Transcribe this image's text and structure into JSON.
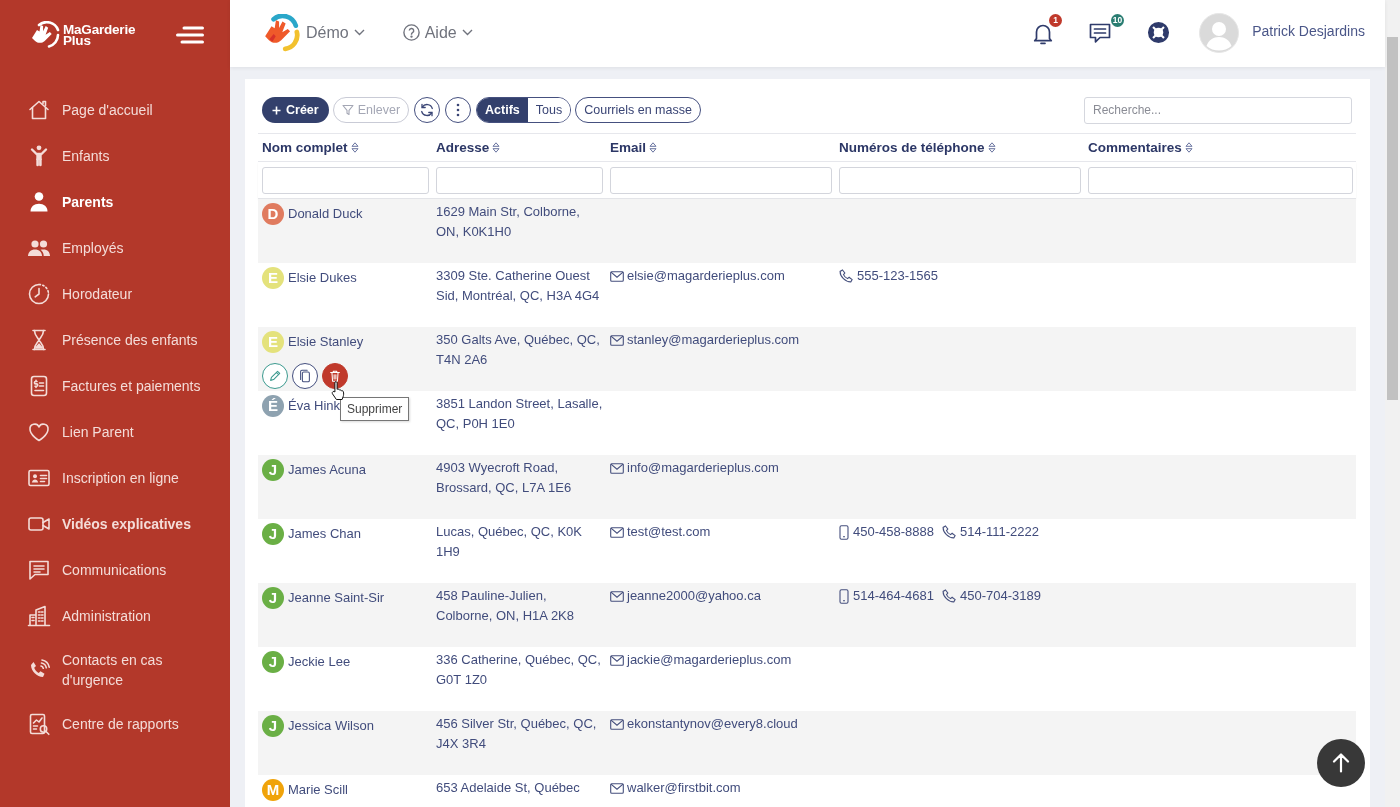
{
  "sidebar": {
    "logo_text": "MaGarderie Plus",
    "items": [
      {
        "label": "Page d'accueil",
        "selected": false,
        "emphasized": false
      },
      {
        "label": "Enfants",
        "selected": false,
        "emphasized": false
      },
      {
        "label": "Parents",
        "selected": true,
        "emphasized": false
      },
      {
        "label": "Employés",
        "selected": false,
        "emphasized": false
      },
      {
        "label": "Horodateur",
        "selected": false,
        "emphasized": false
      },
      {
        "label": "Présence des enfants",
        "selected": false,
        "emphasized": false
      },
      {
        "label": "Factures et paiements",
        "selected": false,
        "emphasized": false
      },
      {
        "label": "Lien Parent",
        "selected": false,
        "emphasized": false
      },
      {
        "label": "Inscription en ligne",
        "selected": false,
        "emphasized": false
      },
      {
        "label": "Vidéos explicatives",
        "selected": false,
        "emphasized": true
      },
      {
        "label": "Communications",
        "selected": false,
        "emphasized": false
      },
      {
        "label": "Administration",
        "selected": false,
        "emphasized": false
      },
      {
        "label": "Contacts en cas d'urgence",
        "selected": false,
        "emphasized": false
      },
      {
        "label": "Centre de rapports",
        "selected": false,
        "emphasized": false
      }
    ]
  },
  "topbar": {
    "org_menu": "Démo",
    "help_menu": "Aide",
    "notification_badge": "1",
    "message_badge": "10",
    "user_name": "Patrick Desjardins"
  },
  "toolbar": {
    "create_button": "Créer",
    "remove_button": {
      "label": "Enlever",
      "disabled": true
    },
    "status_tabs": [
      {
        "label": "Actifs",
        "selected": true
      },
      {
        "label": "Tous",
        "selected": false
      }
    ],
    "bulk_email_button": "Courriels en masse",
    "search": {
      "placeholder": "Recherche..."
    }
  },
  "table": {
    "columns": [
      "Nom complet",
      "Adresse",
      "Email",
      "Numéros de téléphone",
      "Commentaires"
    ],
    "rows": [
      {
        "initial": "D",
        "color": "#e07b5f",
        "name": "Donald Duck",
        "address": "1629 Main Str, Colborne, ON, K0K1H0"
      },
      {
        "initial": "E",
        "color": "#e4e27c",
        "name": "Elsie Dukes",
        "address": "3309 Ste. Catherine Ouest Sid, Montréal, QC, H3A 4G4",
        "email": "elsie@magarderieplus.com",
        "phones": [
          {
            "kind": "landline",
            "number": "555-123-1565"
          }
        ]
      },
      {
        "initial": "E",
        "color": "#e4e27c",
        "name": "Elsie Stanley",
        "address": "350 Galts Ave, Québec, QC, T4N 2A6",
        "email": "stanley@magarderieplus.com",
        "actions": [
          {
            "kind": "edit",
            "hovered": false
          },
          {
            "kind": "copy",
            "hovered": false
          },
          {
            "kind": "delete",
            "hovered": true,
            "tooltip": "Supprimer"
          }
        ]
      },
      {
        "initial": "É",
        "color": "#8ea2b0",
        "name": "Éva Hink",
        "address": "3851 Landon Street, Lasalle, QC, P0H 1E0"
      },
      {
        "initial": "J",
        "color": "#6aaf45",
        "name": "James Acuna",
        "address": "4903 Wyecroft Road, Brossard, QC, L7A 1E6",
        "email": "info@magarderieplus.com"
      },
      {
        "initial": "J",
        "color": "#6aaf45",
        "name": "James Chan",
        "address": "Lucas, Québec, QC, K0K 1H9",
        "email": "test@test.com",
        "phones": [
          {
            "kind": "mobile",
            "number": "450-458-8888"
          },
          {
            "kind": "landline",
            "number": "514-111-2222"
          }
        ]
      },
      {
        "initial": "J",
        "color": "#6aaf45",
        "name": "Jeanne Saint-Sir",
        "address": "458 Pauline-Julien, Colborne, ON, H1A 2K8",
        "email": "jeanne2000@yahoo.ca",
        "phones": [
          {
            "kind": "mobile",
            "number": "514-464-4681"
          },
          {
            "kind": "landline",
            "number": "450-704-3189"
          }
        ]
      },
      {
        "initial": "J",
        "color": "#6aaf45",
        "name": "Jeckie Lee",
        "address": "336 Catherine, Québec, QC, G0T 1Z0",
        "email": "jackie@magarderieplus.com"
      },
      {
        "initial": "J",
        "color": "#6aaf45",
        "name": "Jessica Wilson",
        "address": "456 Silver Str, Québec, QC, J4X 3R4",
        "email": "ekonstantynov@every8.cloud"
      },
      {
        "initial": "M",
        "color": "#f0a30a",
        "name": "Marie Scill",
        "address": "653 Adelaide St, Québec",
        "email": "walker@firstbit.com"
      }
    ]
  }
}
